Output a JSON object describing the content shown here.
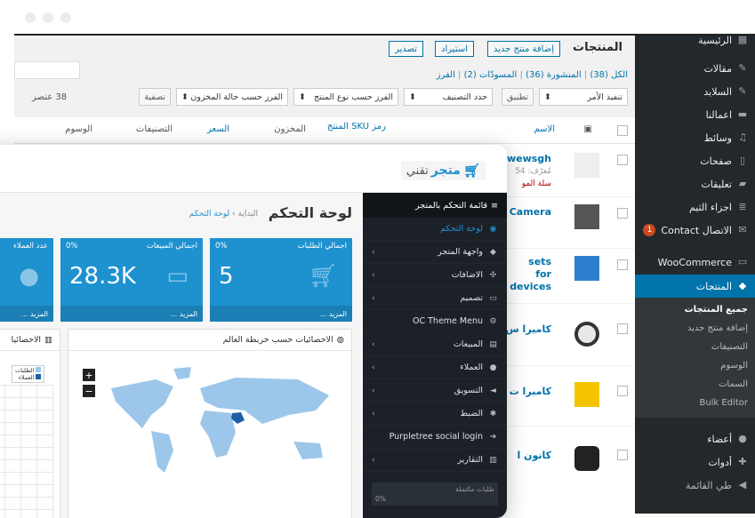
{
  "wp": {
    "sidebar": [
      {
        "label": "الرئيسية",
        "icon": "dashboard-icon"
      },
      {
        "label": "مقالات",
        "icon": "pin-icon"
      },
      {
        "label": "السلايد",
        "icon": "pin-icon"
      },
      {
        "label": "اعمالنا",
        "icon": "folder-icon"
      },
      {
        "label": "وسائط",
        "icon": "media-icon"
      },
      {
        "label": "صفحات",
        "icon": "page-icon"
      },
      {
        "label": "تعليقات",
        "icon": "comment-icon"
      },
      {
        "label": "اجزاء الثيم",
        "icon": "grid-icon"
      },
      {
        "label": "الاتصال Contact",
        "icon": "mail-icon",
        "badge": "1"
      },
      {
        "label": "WooCommerce",
        "icon": "woo-icon"
      },
      {
        "label": "المنتجات",
        "icon": "box-icon",
        "active": true
      }
    ],
    "submenu": [
      "جميع المنتجات",
      "إضافة منتج جديد",
      "التصنيفات",
      "الوسوم",
      "السمات",
      "Bulk Editor"
    ],
    "sidebar_bottom": [
      {
        "label": "أعضاء",
        "icon": "user-icon"
      },
      {
        "label": "أدوات",
        "icon": "wrench-icon"
      },
      {
        "label": "طي القائمة",
        "icon": "collapse-icon"
      }
    ],
    "page_title": "المنتجات",
    "buttons": {
      "add": "إضافة منتج جديد",
      "import": "استيراد",
      "export": "تصدير"
    },
    "filters_links": {
      "all": "الكل",
      "all_count": "(38)",
      "published": "المنشورة",
      "published_count": "(36)",
      "drafts": "المسودّات",
      "drafts_count": "(2)",
      "sort": "الفرز"
    },
    "bulk_action": "تنفيذ الأمر",
    "apply": "تطبيق",
    "category": "حدد التصنيف",
    "type": "الفرز حسب نوع المنتج",
    "stock": "الفرز حسب حالة المخزون",
    "filter": "تصفية",
    "items_count": "38 عنصر",
    "columns": {
      "name": "الاسم",
      "sku": "رمز SKU المنتج",
      "stock": "المخزون",
      "price": "السعر",
      "cats": "التصنيفات",
      "tags": "الوسوم"
    },
    "rows": [
      "wewsgh",
      "Camera",
      "sets for devices",
      "كاميرا س",
      "كاميرا ت",
      "كانون ا"
    ],
    "row0_sub": "مُعرّف: 54",
    "row0_cart": "سلة المو"
  },
  "oc": {
    "logo_main": "متجر",
    "logo_sub": "تقني",
    "nav_title": "قائمة التحكم بالمتجر",
    "nav": [
      {
        "label": "لوحة التحكم",
        "active": true,
        "chev": false
      },
      {
        "label": "واجهة المتجر",
        "chev": true
      },
      {
        "label": "الاضافات",
        "chev": true
      },
      {
        "label": "تصميم",
        "chev": true
      },
      {
        "label": "OC Theme Menu",
        "chev": false
      },
      {
        "label": "المبيعات",
        "chev": true
      },
      {
        "label": "العملاء",
        "chev": true
      },
      {
        "label": "التسويق",
        "chev": true
      },
      {
        "label": "الضبط",
        "chev": true
      },
      {
        "label": "Purpletree social login",
        "chev": false
      },
      {
        "label": "التقارير",
        "chev": true
      }
    ],
    "progress_label": "طلبات مكتملة",
    "progress_value": "0%",
    "title": "لوحة التحكم",
    "crumb_home": "البداية",
    "crumb_sep": "›",
    "crumb_current": "لوحة التحكم",
    "tiles": [
      {
        "title": "اجمالي الطلبات",
        "pct": "0%",
        "value": "5",
        "more": "المزيد ..."
      },
      {
        "title": "اجمالي المبيعات",
        "pct": "0%",
        "value": "28.3K",
        "more": "المزيد ..."
      },
      {
        "title": "عدد العملاء",
        "pct": "0%",
        "value": "",
        "more": "المزيد ..."
      }
    ],
    "map_title": "الاحصائيات حسب خريطة العالم",
    "chart_title": "الاحصائيا",
    "legend": [
      "الطلبات",
      "العملاء"
    ]
  }
}
